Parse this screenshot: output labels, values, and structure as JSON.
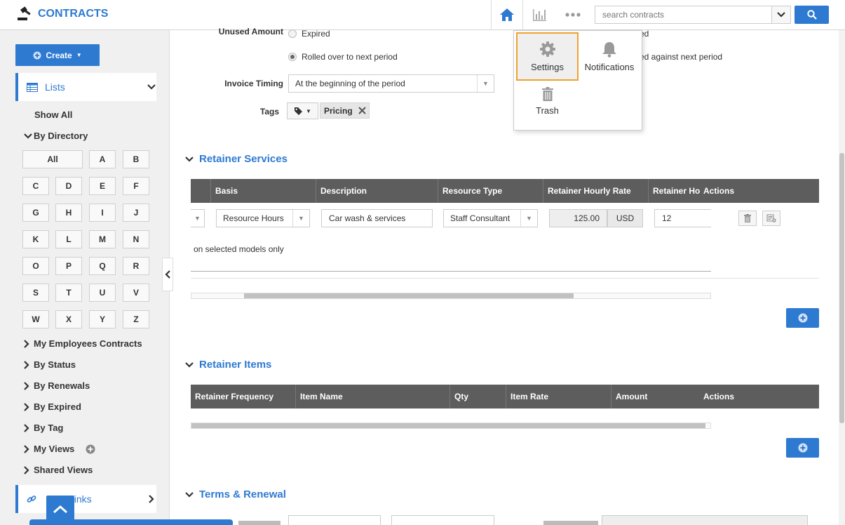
{
  "header": {
    "app_title": "CONTRACTS",
    "search_placeholder": "search contracts",
    "accent": "#2e7ad1"
  },
  "sidebar": {
    "create_label": "Create",
    "lists_label": "Lists",
    "show_all": "Show All",
    "by_directory": "By Directory",
    "letters": [
      "All",
      "A",
      "B",
      "C",
      "D",
      "E",
      "F",
      "G",
      "H",
      "I",
      "J",
      "K",
      "L",
      "M",
      "N",
      "O",
      "P",
      "Q",
      "R",
      "S",
      "T",
      "U",
      "V",
      "W",
      "X",
      "Y",
      "Z"
    ],
    "tree": [
      "My Employees Contracts",
      "By Status",
      "By Renewals",
      "By Expired",
      "By Tag",
      "My Views",
      "Shared Views"
    ],
    "quick_links": "Links"
  },
  "form": {
    "unused_amount_label": "Unused Amount",
    "opt_expired": "Expired",
    "opt_rolled": "Rolled over to next period",
    "opt_right_1": "ed",
    "opt_right_2": "ed against next period",
    "invoice_timing_label": "Invoice Timing",
    "invoice_timing_value": "At the beginning of the period",
    "tags_label": "Tags",
    "tag_value": "Pricing"
  },
  "retainer_services": {
    "title": "Retainer Services",
    "columns": [
      "Basis",
      "Description",
      "Resource Type",
      "Retainer Hourly Rate",
      "Retainer Ho",
      "Actions"
    ],
    "row": {
      "basis": "Resource Hours",
      "description": "Car wash & services",
      "resource_type": "Staff Consultant",
      "rate": "125.00",
      "currency": "USD",
      "hours": "12"
    },
    "note": "on  selected models only"
  },
  "retainer_items": {
    "title": "Retainer Items",
    "columns": [
      "Retainer Frequency",
      "Item Name",
      "Qty",
      "Item Rate",
      "Amount",
      "Actions"
    ]
  },
  "terms": {
    "title": "Terms & Renewal"
  },
  "popup": {
    "settings": "Settings",
    "notifications": "Notifications",
    "trash": "Trash",
    "highlight": "#f0a030"
  }
}
